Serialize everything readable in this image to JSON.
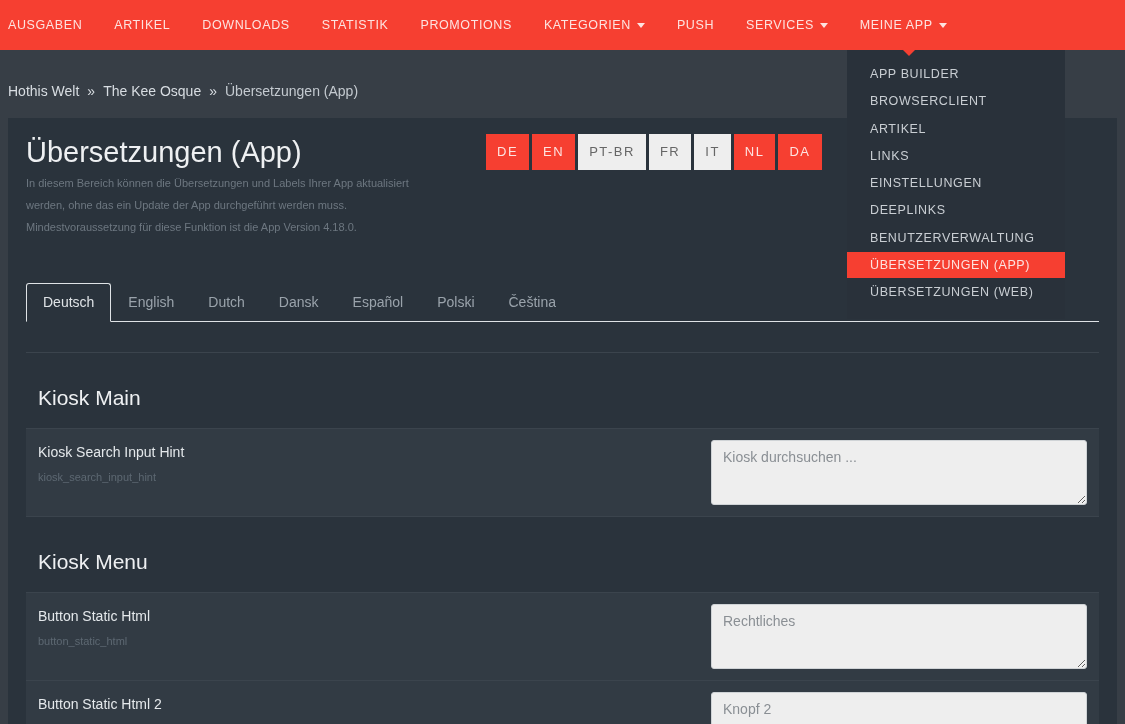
{
  "nav": [
    {
      "label": "AUSGABEN",
      "dropdown": false
    },
    {
      "label": "ARTIKEL",
      "dropdown": false
    },
    {
      "label": "DOWNLOADS",
      "dropdown": false
    },
    {
      "label": "STATISTIK",
      "dropdown": false
    },
    {
      "label": "PROMOTIONS",
      "dropdown": false
    },
    {
      "label": "KATEGORIEN",
      "dropdown": true
    },
    {
      "label": "PUSH",
      "dropdown": false
    },
    {
      "label": "SERVICES",
      "dropdown": true
    },
    {
      "label": "MEINE APP",
      "dropdown": true
    }
  ],
  "menu": [
    {
      "label": "APP BUILDER",
      "selected": false
    },
    {
      "label": "BROWSERCLIENT",
      "selected": false
    },
    {
      "label": "ARTIKEL",
      "selected": false
    },
    {
      "label": "LINKS",
      "selected": false
    },
    {
      "label": "EINSTELLUNGEN",
      "selected": false
    },
    {
      "label": "DEEPLINKS",
      "selected": false
    },
    {
      "label": "BENUTZERVERWALTUNG",
      "selected": false
    },
    {
      "label": "ÜBERSETZUNGEN (APP)",
      "selected": true
    },
    {
      "label": "ÜBERSETZUNGEN (WEB)",
      "selected": false
    }
  ],
  "breadcrumb": [
    {
      "label": "Hothis Welt"
    },
    {
      "separator": "»"
    },
    {
      "label": "The Kee Osque"
    },
    {
      "separator": "»"
    },
    {
      "label": "Übersetzungen (App)"
    }
  ],
  "title": "Übersetzungen (App)",
  "description": [
    "In diesem Bereich können die Übersetzungen und Labels Ihrer App aktualisiert",
    "werden, ohne das ein Update der App durchgeführt werden muss.",
    "Mindestvoraussetzung für diese Funktion ist die App Version 4.18.0."
  ],
  "languages": [
    {
      "label": "DE",
      "selected": true
    },
    {
      "label": "EN",
      "selected": true
    },
    {
      "label": "PT-BR",
      "selected": false
    },
    {
      "label": "FR",
      "selected": false
    },
    {
      "label": "IT",
      "selected": false
    },
    {
      "label": "NL",
      "selected": true
    },
    {
      "label": "DA",
      "selected": true
    }
  ],
  "tabs": [
    {
      "label": "Deutsch",
      "selected": true
    },
    {
      "label": "English",
      "selected": false
    },
    {
      "label": "Dutch",
      "selected": false
    },
    {
      "label": "Dansk",
      "selected": false
    },
    {
      "label": "Español",
      "selected": false
    },
    {
      "label": "Polski",
      "selected": false
    },
    {
      "label": "Čeština",
      "selected": false
    }
  ],
  "sections": [
    {
      "heading": "Kiosk Main",
      "rows": [
        {
          "label": "Kiosk Search Input Hint",
          "key": "kiosk_search_input_hint",
          "value": "Kiosk durchsuchen ..."
        }
      ]
    },
    {
      "heading": "Kiosk Menu",
      "rows": [
        {
          "label": "Button Static Html",
          "key": "button_static_html",
          "value": "Rechtliches"
        },
        {
          "label": "Button Static Html 2",
          "value": "Knopf 2"
        }
      ]
    }
  ]
}
